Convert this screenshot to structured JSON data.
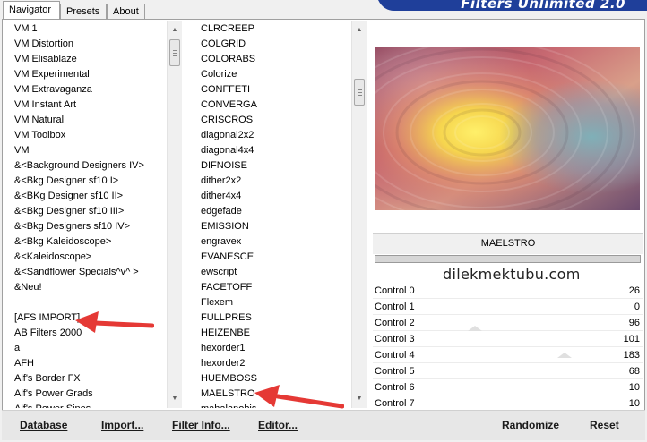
{
  "tabs": [
    {
      "label": "Navigator"
    },
    {
      "label": "Presets"
    },
    {
      "label": "About"
    }
  ],
  "banner_title": "Filters Unlimited 2.0",
  "categories": {
    "items": [
      "VM 1",
      "VM Distortion",
      "VM Elisablaze",
      "VM Experimental",
      "VM Extravaganza",
      "VM Instant Art",
      "VM Natural",
      "VM Toolbox",
      "VM",
      "&<Background Designers IV>",
      "&<Bkg Designer sf10 I>",
      "&<BKg Designer sf10 II>",
      "&<Bkg Designer sf10 III>",
      "&<Bkg Designers sf10 IV>",
      "&<Bkg Kaleidoscope>",
      "&<Kaleidoscope>",
      "&<Sandflower Specials^v^ >",
      "&Neu!",
      "",
      "[AFS IMPORT]",
      "AB Filters 2000",
      "a",
      "AFH",
      "Alf's Border FX",
      "Alf's Power Grads",
      "Alf's Power Sines"
    ]
  },
  "filters": {
    "items": [
      "CLRCREEP",
      "COLGRID",
      "COLORABS",
      "Colorize",
      "CONFFETI",
      "CONVERGA",
      "CRISCROS",
      "diagonal2x2",
      "diagonal4x4",
      "DIFNOISE",
      "dither2x2",
      "dither4x4",
      "edgefade",
      "EMISSION",
      "engravex",
      "EVANESCE",
      "ewscript",
      "FACETOFF",
      "Flexem",
      "FULLPRES",
      "HEIZENBE",
      "hexorder1",
      "hexorder2",
      "HUEMBOSS",
      "MAELSTRO",
      "mahalanobis"
    ]
  },
  "selected_filter": "MAELSTRO",
  "watermark": "dilekmektubu.com",
  "controls": [
    {
      "label": "Control 0",
      "value": "26"
    },
    {
      "label": "Control 1",
      "value": "0"
    },
    {
      "label": "Control 2",
      "value": "96"
    },
    {
      "label": "Control 3",
      "value": "101"
    },
    {
      "label": "Control 4",
      "value": "183"
    },
    {
      "label": "Control 5",
      "value": "68"
    },
    {
      "label": "Control 6",
      "value": "10"
    },
    {
      "label": "Control 7",
      "value": "10"
    }
  ],
  "buttons": {
    "database": "Database",
    "import": "Import...",
    "filter_info": "Filter Info...",
    "editor": "Editor...",
    "randomize": "Randomize",
    "reset": "Reset"
  },
  "colors": {
    "annotation_arrow": "#e53935",
    "banner_blue": "#1f3f9a"
  },
  "icons": [
    "scroll-up-arrow-icon",
    "scroll-down-arrow-icon",
    "red-arrow-annotation"
  ]
}
